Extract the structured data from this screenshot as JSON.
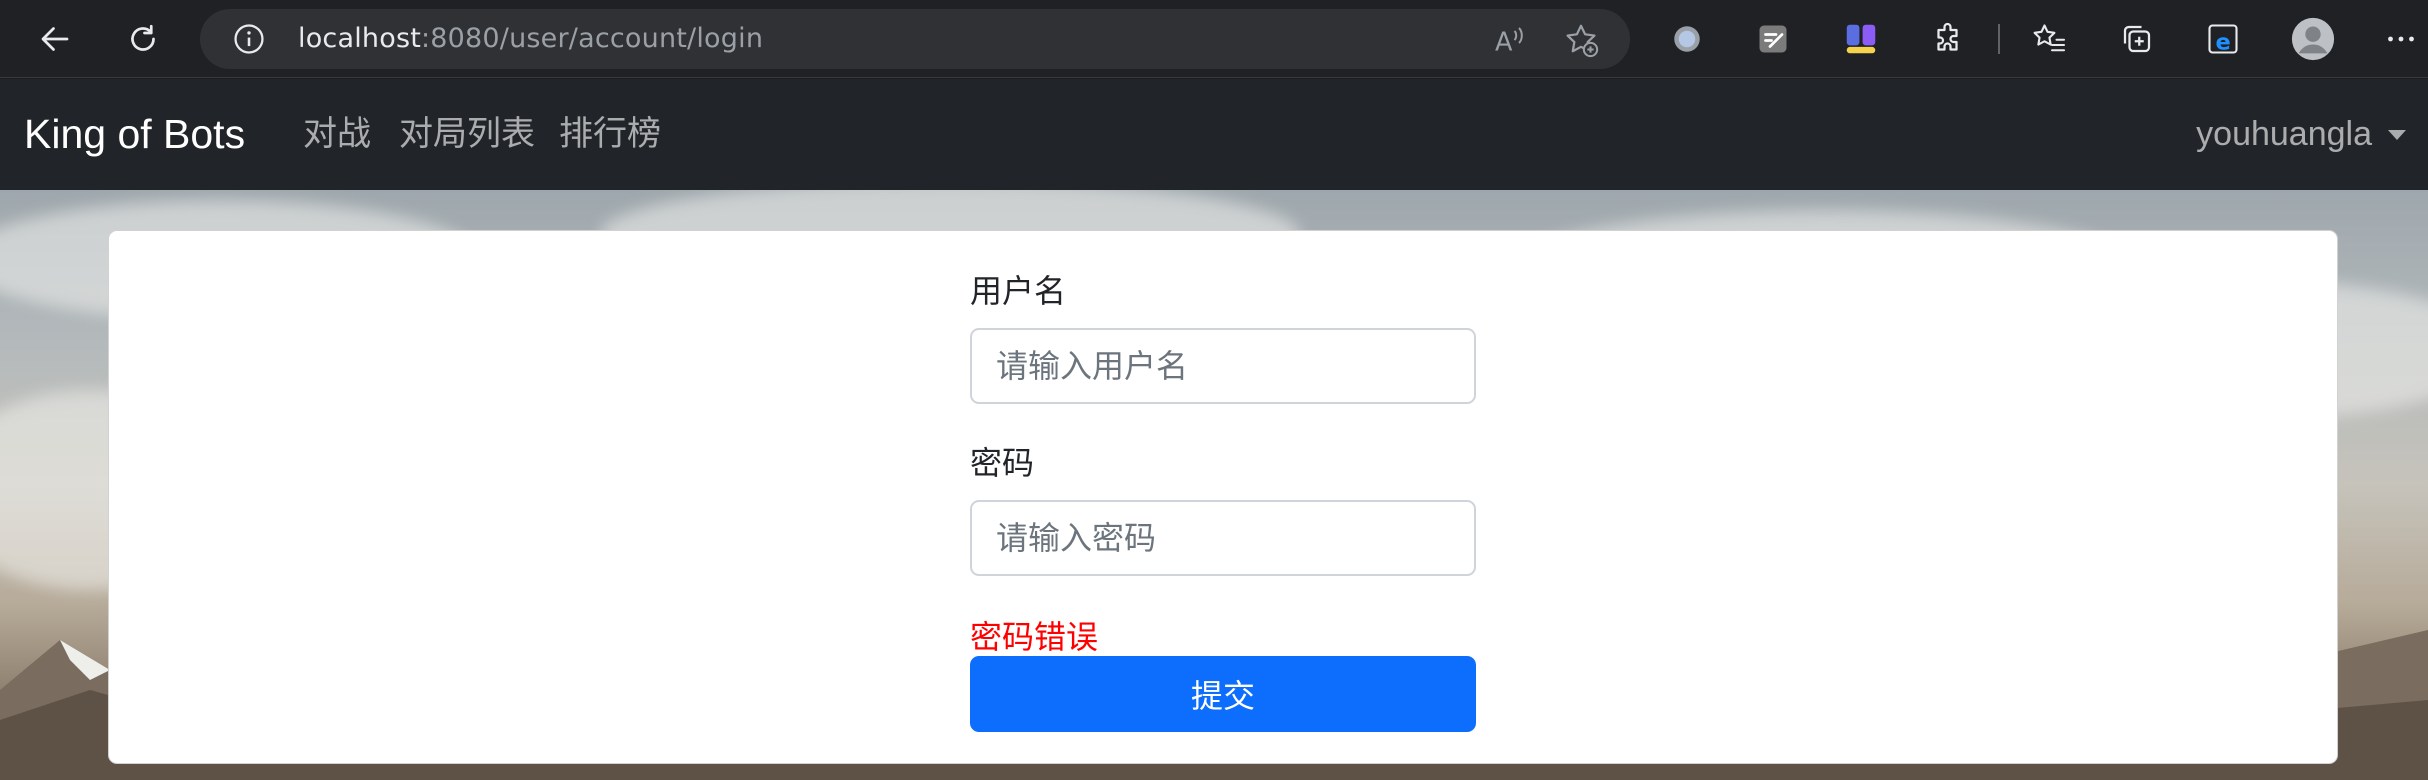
{
  "browser": {
    "url_host": "localhost",
    "url_path": ":8080/user/account/login",
    "icons": [
      "back-icon",
      "refresh-icon",
      "info-icon",
      "read-aloud-icon",
      "add-favorite-icon",
      "extension-circle-icon",
      "extension-edit-icon",
      "extension-puzzle-color-icon",
      "extensions-icon",
      "favorites-icon",
      "collections-icon",
      "ie-mode-icon",
      "profile-avatar-icon",
      "more-icon"
    ]
  },
  "navbar": {
    "brand": "King of Bots",
    "links": [
      "对战",
      "对局列表",
      "排行榜"
    ],
    "username": "youhuangla"
  },
  "form": {
    "username_label": "用户名",
    "username_placeholder": "请输入用户名",
    "username_value": "",
    "password_label": "密码",
    "password_placeholder": "请输入密码",
    "password_value": "",
    "error_message": "密码错误",
    "submit_label": "提交"
  },
  "colors": {
    "navbar_bg": "#212529",
    "primary": "#0d6efd",
    "error": "#ff0000",
    "browser_bg": "#202124"
  }
}
